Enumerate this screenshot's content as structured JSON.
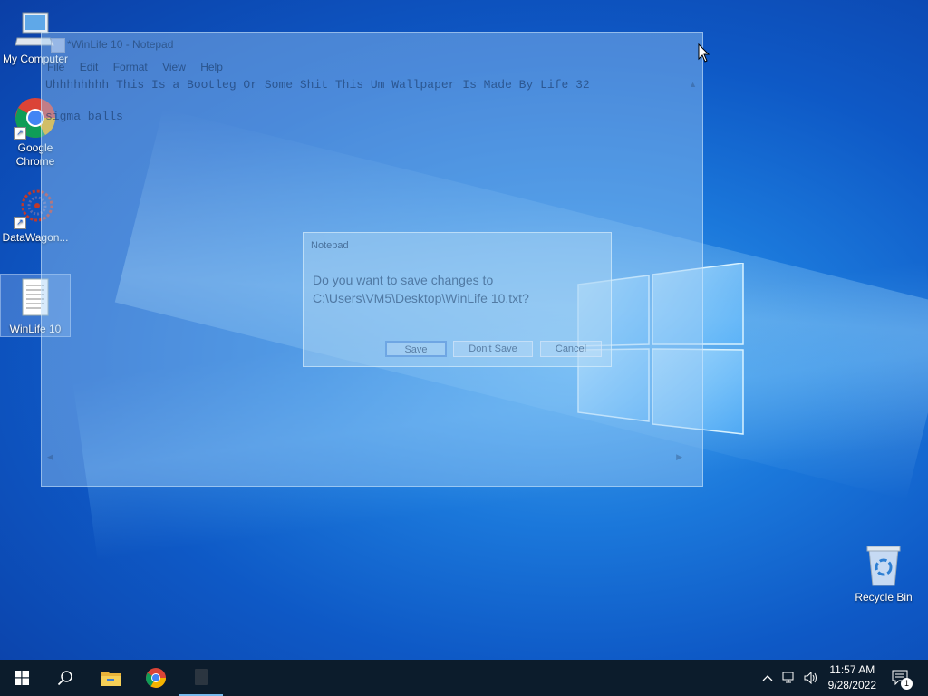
{
  "desktop": {
    "icons": [
      {
        "label": "My Computer"
      },
      {
        "label": "Google Chrome"
      },
      {
        "label": "DataWagon..."
      },
      {
        "label": "WinLife 10"
      }
    ],
    "recycle_bin": {
      "label": "Recycle Bin"
    }
  },
  "notepad": {
    "title": "*WinLife 10 - Notepad",
    "menu": [
      "File",
      "Edit",
      "Format",
      "View",
      "Help"
    ],
    "line1": "Uhhhhhhhh This Is a Bootleg Or Some Shit This Um Wallpaper Is Made By Life 32",
    "line2": "",
    "line3": "sigma balls"
  },
  "dialog": {
    "title": "Notepad",
    "message_line1": "Do you want to save changes to",
    "message_line2": "C:\\Users\\VM5\\Desktop\\WinLife 10.txt?",
    "save_label": "Save",
    "dont_save_label": "Don't Save",
    "cancel_label": "Cancel"
  },
  "taskbar": {
    "time": "11:57 AM",
    "date": "9/28/2022",
    "notification_count": "1",
    "pinned": [
      "start-icon",
      "search-icon",
      "file-explorer-icon",
      "chrome-icon",
      "notepad-icon"
    ]
  },
  "colors": {
    "taskbar": "#0c1c2c",
    "wallpaper": "#1b78db",
    "accent": "#76b9ed"
  }
}
